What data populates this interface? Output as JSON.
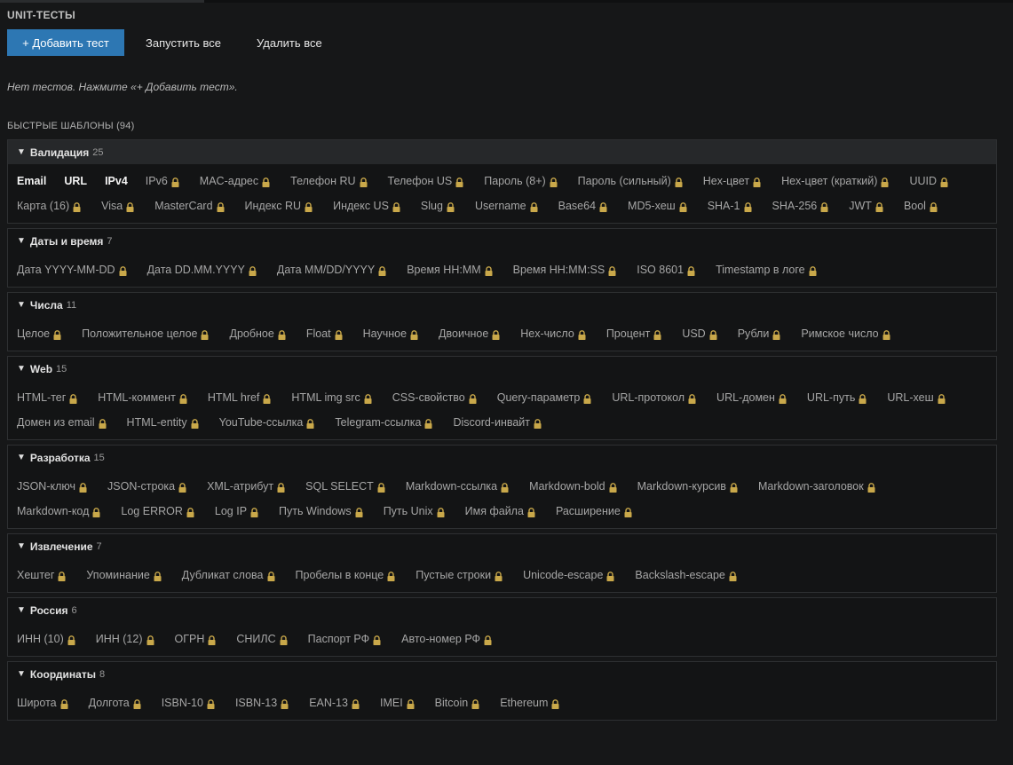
{
  "header": {
    "title": "UNIT-ТЕСТЫ"
  },
  "toolbar": {
    "add_label": "+ Добавить тест",
    "run_all_label": "Запустить все",
    "delete_all_label": "Удалить все"
  },
  "empty_state": "Нет тестов. Нажмите «+ Добавить тест».",
  "quick_templates": {
    "title": "БЫСТРЫЕ ШАБЛОНЫ (94)"
  },
  "colors": {
    "accent": "#2d77b3",
    "lock": "#c9a84a",
    "background": "#161718"
  },
  "icons": {
    "lock": "lock-icon",
    "expand": "triangle-down-icon"
  },
  "groups": [
    {
      "id": "validation",
      "name": "Валидация",
      "count": "25",
      "expanded_highlight": true,
      "items": [
        {
          "label": "Email",
          "locked": false
        },
        {
          "label": "URL",
          "locked": false
        },
        {
          "label": "IPv4",
          "locked": false
        },
        {
          "label": "IPv6",
          "locked": true
        },
        {
          "label": "MAC-адрес",
          "locked": true
        },
        {
          "label": "Телефон RU",
          "locked": true
        },
        {
          "label": "Телефон US",
          "locked": true
        },
        {
          "label": "Пароль (8+)",
          "locked": true
        },
        {
          "label": "Пароль (сильный)",
          "locked": true
        },
        {
          "label": "Hex-цвет",
          "locked": true
        },
        {
          "label": "Hex-цвет (краткий)",
          "locked": true
        },
        {
          "label": "UUID",
          "locked": true
        },
        {
          "label": "Карта (16)",
          "locked": true
        },
        {
          "label": "Visa",
          "locked": true
        },
        {
          "label": "MasterCard",
          "locked": true
        },
        {
          "label": "Индекс RU",
          "locked": true
        },
        {
          "label": "Индекс US",
          "locked": true
        },
        {
          "label": "Slug",
          "locked": true
        },
        {
          "label": "Username",
          "locked": true
        },
        {
          "label": "Base64",
          "locked": true
        },
        {
          "label": "MD5-хеш",
          "locked": true
        },
        {
          "label": "SHA-1",
          "locked": true
        },
        {
          "label": "SHA-256",
          "locked": true
        },
        {
          "label": "JWT",
          "locked": true
        },
        {
          "label": "Bool",
          "locked": true
        }
      ]
    },
    {
      "id": "dates",
      "name": "Даты и время",
      "count": "7",
      "items": [
        {
          "label": "Дата YYYY-MM-DD",
          "locked": true
        },
        {
          "label": "Дата DD.MM.YYYY",
          "locked": true
        },
        {
          "label": "Дата MM/DD/YYYY",
          "locked": true
        },
        {
          "label": "Время HH:MM",
          "locked": true
        },
        {
          "label": "Время HH:MM:SS",
          "locked": true
        },
        {
          "label": "ISO 8601",
          "locked": true
        },
        {
          "label": "Timestamp в логе",
          "locked": true
        }
      ]
    },
    {
      "id": "numbers",
      "name": "Числа",
      "count": "11",
      "items": [
        {
          "label": "Целое",
          "locked": true
        },
        {
          "label": "Положительное целое",
          "locked": true
        },
        {
          "label": "Дробное",
          "locked": true
        },
        {
          "label": "Float",
          "locked": true
        },
        {
          "label": "Научное",
          "locked": true
        },
        {
          "label": "Двоичное",
          "locked": true
        },
        {
          "label": "Hex-число",
          "locked": true
        },
        {
          "label": "Процент",
          "locked": true
        },
        {
          "label": "USD",
          "locked": true
        },
        {
          "label": "Рубли",
          "locked": true
        },
        {
          "label": "Римское число",
          "locked": true
        }
      ]
    },
    {
      "id": "web",
      "name": "Web",
      "count": "15",
      "items": [
        {
          "label": "HTML-тег",
          "locked": true
        },
        {
          "label": "HTML-коммент",
          "locked": true
        },
        {
          "label": "HTML href",
          "locked": true
        },
        {
          "label": "HTML img src",
          "locked": true
        },
        {
          "label": "CSS-свойство",
          "locked": true
        },
        {
          "label": "Query-параметр",
          "locked": true
        },
        {
          "label": "URL-протокол",
          "locked": true
        },
        {
          "label": "URL-домен",
          "locked": true
        },
        {
          "label": "URL-путь",
          "locked": true
        },
        {
          "label": "URL-хеш",
          "locked": true
        },
        {
          "label": "Домен из email",
          "locked": true
        },
        {
          "label": "HTML-entity",
          "locked": true
        },
        {
          "label": "YouTube-ссылка",
          "locked": true
        },
        {
          "label": "Telegram-ссылка",
          "locked": true
        },
        {
          "label": "Discord-инвайт",
          "locked": true
        }
      ]
    },
    {
      "id": "dev",
      "name": "Разработка",
      "count": "15",
      "items": [
        {
          "label": "JSON-ключ",
          "locked": true
        },
        {
          "label": "JSON-строка",
          "locked": true
        },
        {
          "label": "XML-атрибут",
          "locked": true
        },
        {
          "label": "SQL SELECT",
          "locked": true
        },
        {
          "label": "Markdown-ссылка",
          "locked": true
        },
        {
          "label": "Markdown-bold",
          "locked": true
        },
        {
          "label": "Markdown-курсив",
          "locked": true
        },
        {
          "label": "Markdown-заголовок",
          "locked": true
        },
        {
          "label": "Markdown-код",
          "locked": true
        },
        {
          "label": "Log ERROR",
          "locked": true
        },
        {
          "label": "Log IP",
          "locked": true
        },
        {
          "label": "Путь Windows",
          "locked": true
        },
        {
          "label": "Путь Unix",
          "locked": true
        },
        {
          "label": "Имя файла",
          "locked": true
        },
        {
          "label": "Расширение",
          "locked": true
        }
      ]
    },
    {
      "id": "extract",
      "name": "Извлечение",
      "count": "7",
      "items": [
        {
          "label": "Хештег",
          "locked": true
        },
        {
          "label": "Упоминание",
          "locked": true
        },
        {
          "label": "Дубликат слова",
          "locked": true
        },
        {
          "label": "Пробелы в конце",
          "locked": true
        },
        {
          "label": "Пустые строки",
          "locked": true
        },
        {
          "label": "Unicode-escape",
          "locked": true
        },
        {
          "label": "Backslash-escape",
          "locked": true
        }
      ]
    },
    {
      "id": "russia",
      "name": "Россия",
      "count": "6",
      "items": [
        {
          "label": "ИНН (10)",
          "locked": true
        },
        {
          "label": "ИНН (12)",
          "locked": true
        },
        {
          "label": "ОГРН",
          "locked": true
        },
        {
          "label": "СНИЛС",
          "locked": true
        },
        {
          "label": "Паспорт РФ",
          "locked": true
        },
        {
          "label": "Авто-номер РФ",
          "locked": true
        }
      ]
    },
    {
      "id": "coords",
      "name": "Координаты",
      "count": "8",
      "items": [
        {
          "label": "Широта",
          "locked": true
        },
        {
          "label": "Долгота",
          "locked": true
        },
        {
          "label": "ISBN-10",
          "locked": true
        },
        {
          "label": "ISBN-13",
          "locked": true
        },
        {
          "label": "EAN-13",
          "locked": true
        },
        {
          "label": "IMEI",
          "locked": true
        },
        {
          "label": "Bitcoin",
          "locked": true
        },
        {
          "label": "Ethereum",
          "locked": true
        }
      ]
    }
  ]
}
